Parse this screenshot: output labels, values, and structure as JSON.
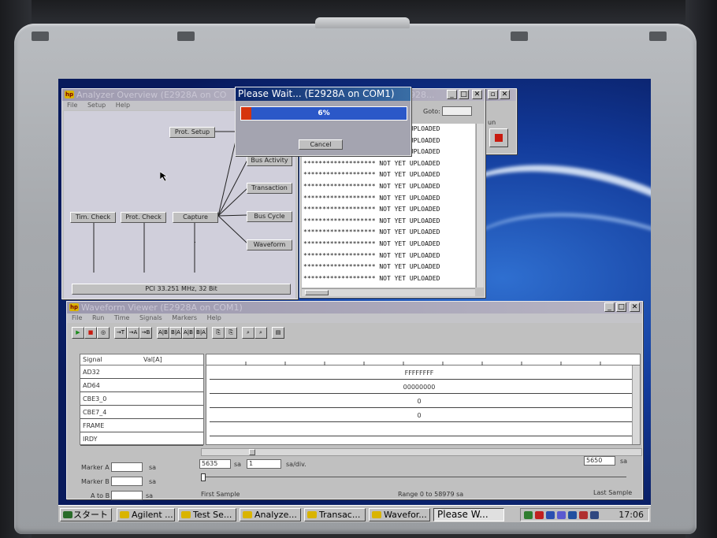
{
  "analyzer_overview": {
    "title": "Analyzer Overview (E2928A on CO",
    "menu": [
      "File",
      "Setup",
      "Help"
    ],
    "nodes": {
      "prot_setup": "Prot. Setup",
      "bus_activity": "Bus Activity",
      "transaction": "Transaction",
      "bus_cycle": "Bus Cycle",
      "waveform": "Waveform",
      "tim_check": "Tim. Check",
      "prot_check": "Prot. Check",
      "capture": "Capture"
    },
    "status": "PCI 33.251 MHz, 32 Bit"
  },
  "list_window": {
    "title_fragment": "2928...",
    "goto_label": "Goto:",
    "goto_value": "",
    "rows": [
      "******************* NOT YET UPLOADED",
      "******************* NOT YET UPLOADED",
      "******************* NOT YET UPLOADED",
      "******************* NOT YET UPLOADED",
      "******************* NOT YET UPLOADED",
      "******************* NOT YET UPLOADED",
      "******************* NOT YET UPLOADED",
      "******************* NOT YET UPLOADED",
      "******************* NOT YET UPLOADED",
      "******************* NOT YET UPLOADED",
      "******************* NOT YET UPLOADED",
      "******************* NOT YET UPLOADED",
      "******************* NOT YET UPLOADED",
      "******************* NOT YET UPLOADED"
    ]
  },
  "run_window": {
    "label": "un"
  },
  "wait_dialog": {
    "title": "Please Wait... (E2928A on COM1)",
    "progress_percent": 6,
    "progress_text": "6%",
    "cancel_label": "Cancel"
  },
  "waveform_viewer": {
    "title": "Waveform Viewer (E2928A on COM1)",
    "menu": [
      "File",
      "Run",
      "Time",
      "Signals",
      "Markers",
      "Help"
    ],
    "toolbar": [
      "▶",
      "■",
      "◎",
      "→T",
      "→A",
      "→B",
      "A|B",
      "B|A",
      "A|B",
      "B|A",
      "⎘",
      "⎘",
      "⌕",
      "⌕",
      "▤"
    ],
    "signal_header": "Signal",
    "value_header": "Val[A]",
    "signals": [
      {
        "name": "AD32",
        "value": "FFFFFFFF"
      },
      {
        "name": "AD64",
        "value": "00000000"
      },
      {
        "name": "CBE3_0",
        "value": "0"
      },
      {
        "name": "CBE7_4",
        "value": "0"
      },
      {
        "name": "FRAME",
        "value": ""
      },
      {
        "name": "IRDY",
        "value": ""
      }
    ],
    "marker_a_label": "Marker A",
    "marker_b_label": "Marker B",
    "a_to_b_label": "A to B",
    "unit_sa": "sa",
    "start_value": "5635",
    "zoom_value": "1",
    "zoom_unit": "sa/div.",
    "end_value": "5650",
    "first_sample": "First Sample",
    "range_text": "Range 0 to 58979 sa",
    "last_sample": "Last Sample"
  },
  "taskbar": {
    "start_label": "スタート",
    "items": [
      "Agilent ...",
      "Test Se...",
      "Analyze...",
      "Transac...",
      "Wavefor...",
      "Please W..."
    ],
    "active_index": 5,
    "clock": "17:06"
  }
}
